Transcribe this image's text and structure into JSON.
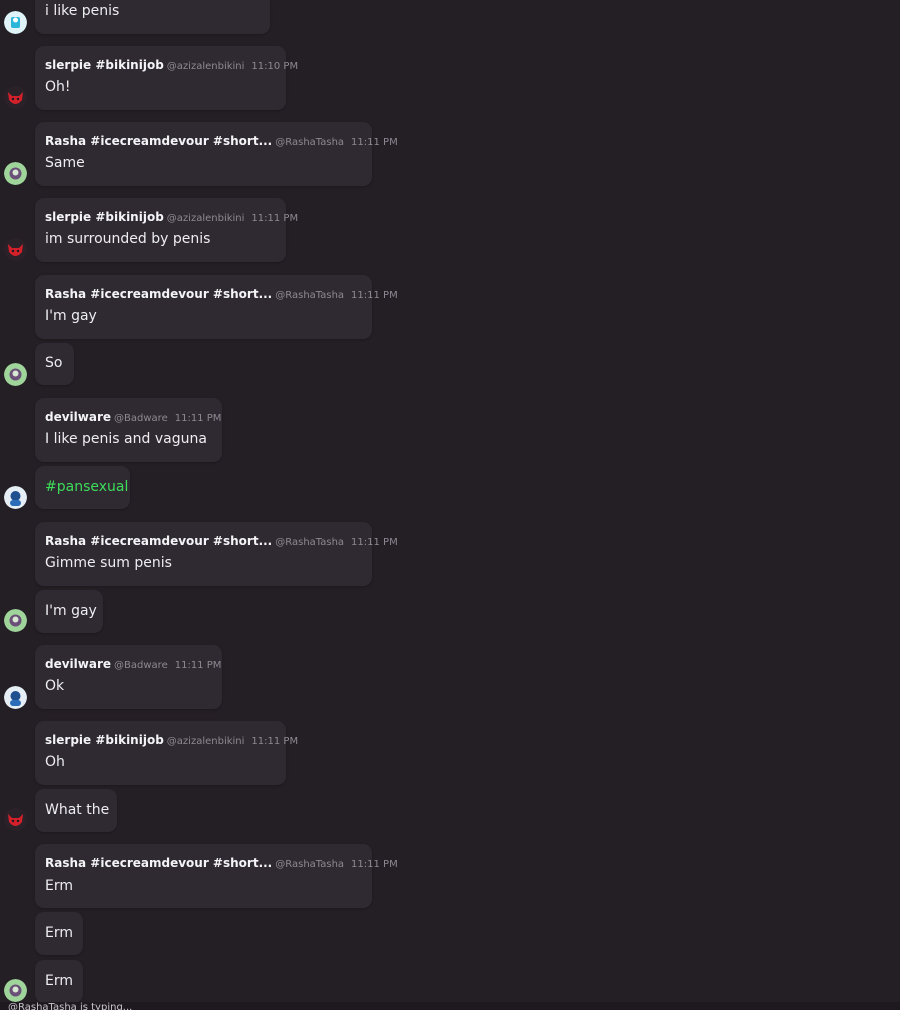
{
  "typing_indicator": "@RashaTasha is typing...",
  "users": {
    "slerpie": {
      "name": "slerpie #bikinijob",
      "handle": "@azizalenbikini"
    },
    "rasha": {
      "name": "Rasha #icecreamdevour #short...",
      "handle": "@RashaTasha"
    },
    "devilware": {
      "name": "devilware",
      "handle": "@Badware"
    }
  },
  "messages": [
    {
      "text": "i like penis"
    },
    {
      "author": "slerpie #bikinijob",
      "handle": "@azizalenbikini",
      "time": "11:10 PM",
      "text": "Oh!"
    },
    {
      "author": "Rasha #icecreamdevour #short...",
      "handle": "@RashaTasha",
      "time": "11:11 PM",
      "text": "Same"
    },
    {
      "author": "slerpie #bikinijob",
      "handle": "@azizalenbikini",
      "time": "11:11 PM",
      "text": "im surrounded by penis"
    },
    {
      "author": "Rasha #icecreamdevour #short...",
      "handle": "@RashaTasha",
      "time": "11:11 PM",
      "text": "I'm gay"
    },
    {
      "text": "So"
    },
    {
      "author": "devilware",
      "handle": "@Badware",
      "time": "11:11 PM",
      "text": "I like penis and vaguna"
    },
    {
      "text": "#pansexual"
    },
    {
      "author": "Rasha #icecreamdevour #short...",
      "handle": "@RashaTasha",
      "time": "11:11 PM",
      "text": "Gimme sum penis"
    },
    {
      "text": "I'm gay"
    },
    {
      "author": "devilware",
      "handle": "@Badware",
      "time": "11:11 PM",
      "text": "Ok"
    },
    {
      "author": "slerpie #bikinijob",
      "handle": "@azizalenbikini",
      "time": "11:11 PM",
      "text": "Oh"
    },
    {
      "text": "What the"
    },
    {
      "author": "Rasha #icecreamdevour #short...",
      "handle": "@RashaTasha",
      "time": "11:11 PM",
      "text": "Erm"
    },
    {
      "text": "Erm"
    },
    {
      "text": "Erm"
    }
  ],
  "colors": {
    "background": "#241f25",
    "bubble": "#2f2a31",
    "hashtag": "#3ddc5a",
    "meta": "#8d8893"
  },
  "icons": {
    "avatar_1": "cyan-character-avatar",
    "avatar_slerpie": "red-devil-avatar",
    "avatar_rasha": "green-character-avatar",
    "avatar_devilware": "blue-character-avatar"
  }
}
